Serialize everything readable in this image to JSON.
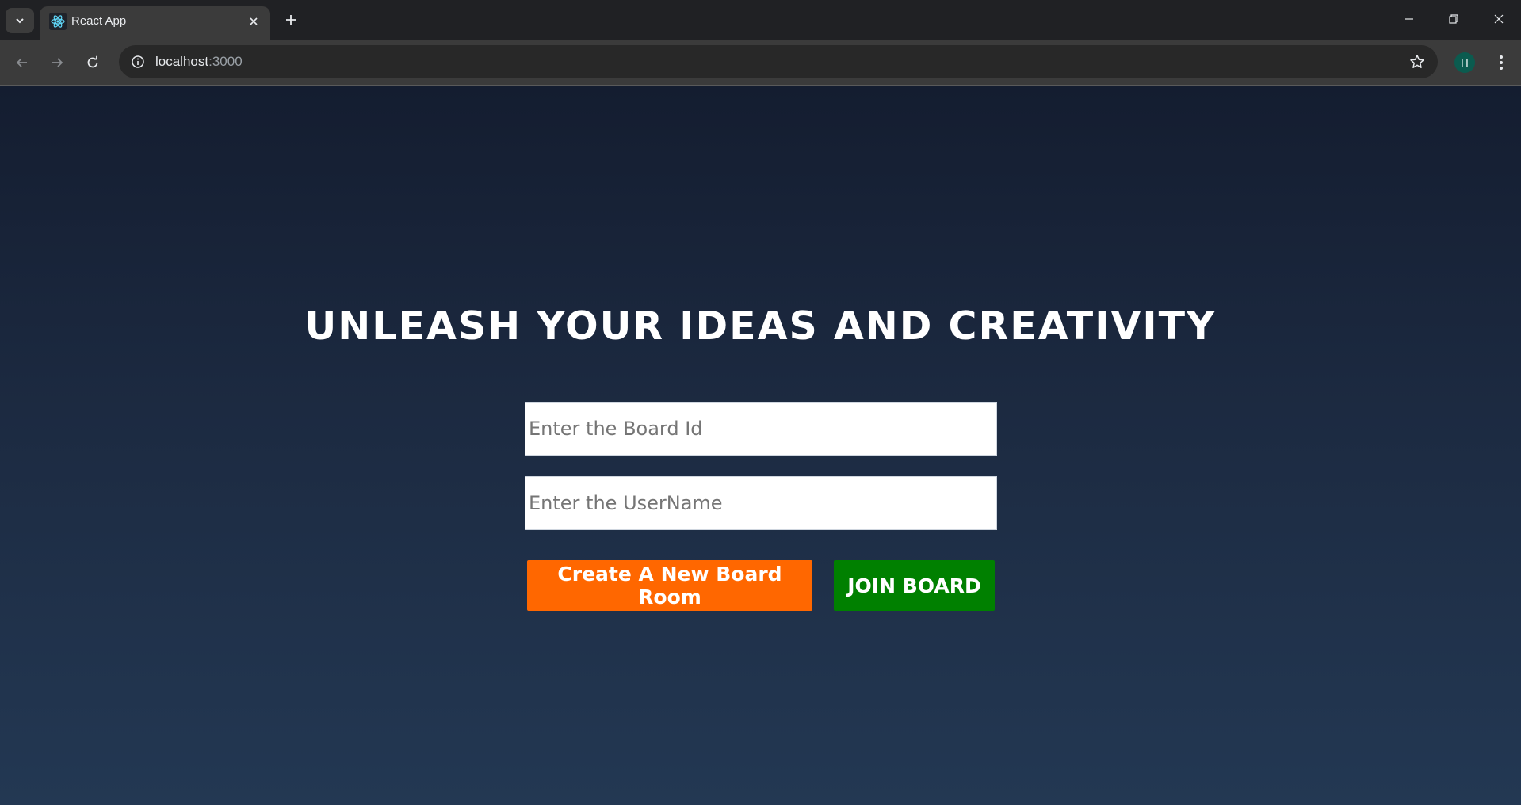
{
  "browser": {
    "tab_title": "React App",
    "url_host": "localhost",
    "url_port": ":3000",
    "profile_initial": "H",
    "icons": {
      "tab_search": "chevron-down-icon",
      "favicon": "react-logo-icon",
      "tab_close": "close-icon",
      "new_tab": "plus-icon",
      "minimize": "minimize-icon",
      "restore": "restore-icon",
      "close_window": "close-icon",
      "back": "arrow-left-icon",
      "forward": "arrow-right-icon",
      "reload": "reload-icon",
      "site_info": "info-icon",
      "bookmark": "star-icon",
      "menu": "kebab-menu-icon"
    }
  },
  "page": {
    "headline": "UNLEASH YOUR IDEAS AND CREATIVITY",
    "board_id_placeholder": "Enter the Board Id",
    "board_id_value": "",
    "username_placeholder": "Enter the UserName",
    "username_value": "",
    "create_button_label": "Create A New Board Room",
    "join_button_label": "JOIN BOARD"
  },
  "colors": {
    "create_button": "#ff6700",
    "join_button": "#008000",
    "background_top": "#141d30",
    "background_bottom": "#233853",
    "headline": "#ffffff"
  }
}
